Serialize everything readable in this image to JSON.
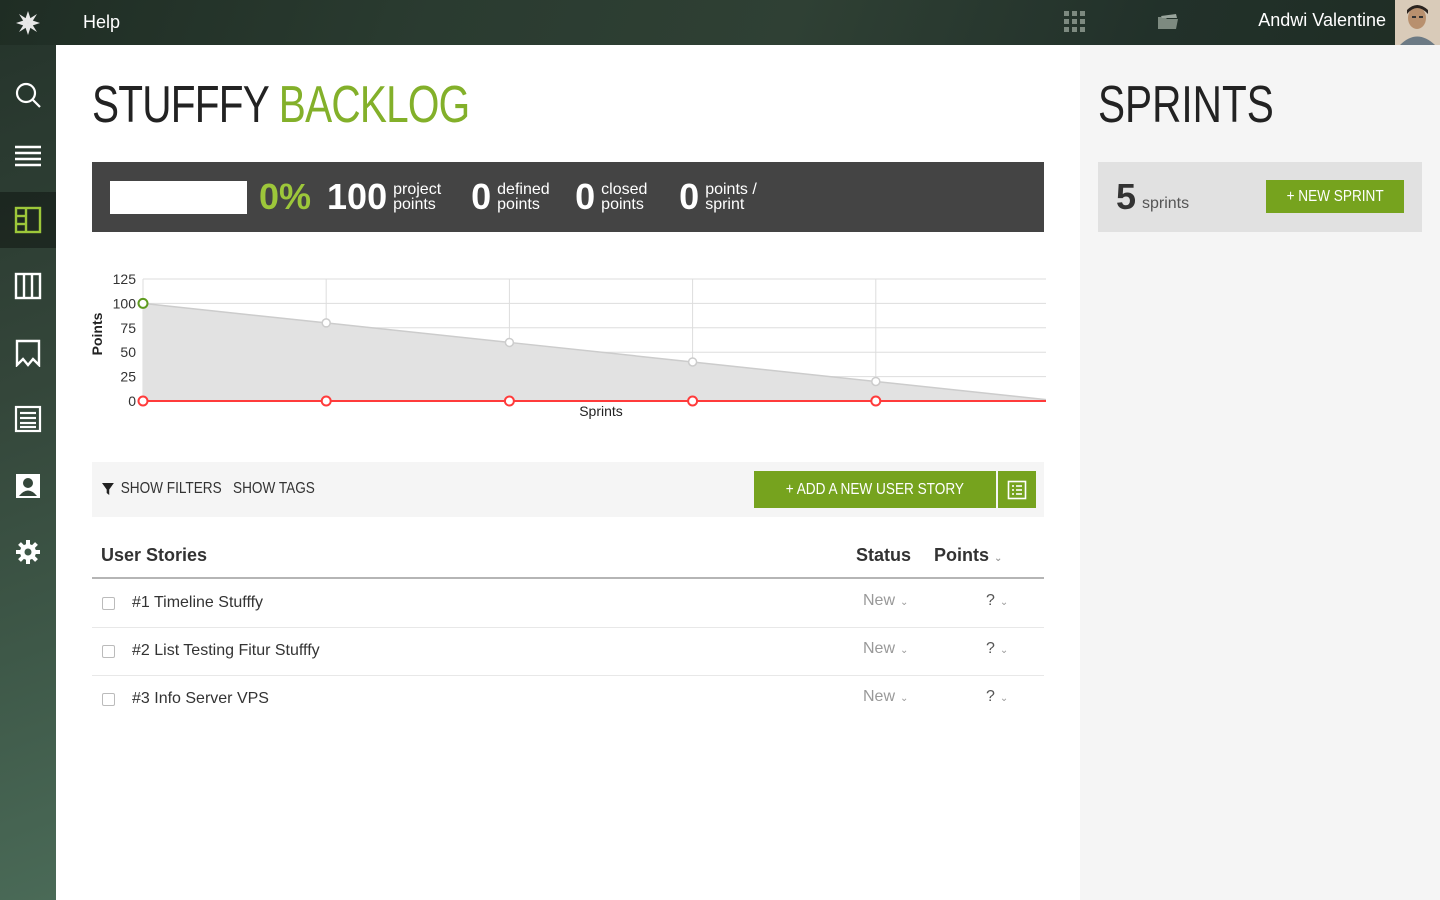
{
  "topbar": {
    "help_label": "Help",
    "user_name": "Andwi Valentine",
    "icons": [
      "taiga-logo-icon",
      "apps-grid-icon",
      "folder-icon",
      "avatar"
    ]
  },
  "sidebar": {
    "items": [
      {
        "icon": "search-icon",
        "active": false
      },
      {
        "icon": "list-icon",
        "active": false
      },
      {
        "icon": "backlog-icon",
        "active": true
      },
      {
        "icon": "kanban-icon",
        "active": false
      },
      {
        "icon": "issues-icon",
        "active": false
      },
      {
        "icon": "wiki-icon",
        "active": false
      },
      {
        "icon": "team-icon",
        "active": false
      },
      {
        "icon": "settings-icon",
        "active": false
      }
    ]
  },
  "main": {
    "title_project": "STUFFFY",
    "title_section": "BACKLOG",
    "summary": {
      "progress_fraction": 0,
      "percent": "0%",
      "project_points_value": "100",
      "project_points_label": "project points",
      "defined_points_value": "0",
      "defined_points_label": "defined points",
      "closed_points_value": "0",
      "closed_points_label": "closed points",
      "points_per_sprint_value": "0",
      "points_per_sprint_label": "points / sprint"
    },
    "filterbar": {
      "show_filters_label": "SHOW FILTERS",
      "show_tags_label": "SHOW TAGS",
      "add_story_label": "+ ADD A NEW USER STORY"
    },
    "table": {
      "col_stories": "User Stories",
      "col_status": "Status",
      "col_points": "Points",
      "rows": [
        {
          "subject": "#1 Timeline Stufffy",
          "status": "New",
          "points": "?"
        },
        {
          "subject": "#2 List Testing Fitur Stufffy",
          "status": "New",
          "points": "?"
        },
        {
          "subject": "#3 Info Server VPS",
          "status": "New",
          "points": "?"
        }
      ]
    }
  },
  "chart_data": {
    "type": "line",
    "x": [
      0,
      1,
      2,
      3,
      4,
      5
    ],
    "ylim": [
      0,
      125
    ],
    "yticks": [
      0,
      25,
      50,
      75,
      100,
      125
    ],
    "xlabel": "Sprints",
    "ylabel": "Points",
    "grid": true,
    "series": [
      {
        "values": [
          100,
          80,
          60,
          40,
          20,
          0
        ],
        "color": "#cccccc",
        "fill": "#e2e2e2"
      },
      {
        "values": [
          0,
          0,
          0,
          0,
          0,
          0
        ],
        "color": "#ff3b3b"
      }
    ],
    "highlight_color": "#5f9b20"
  },
  "sprints": {
    "title": "SPRINTS",
    "count": "5",
    "count_label": "sprints",
    "new_sprint_label": "+ NEW SPRINT"
  }
}
